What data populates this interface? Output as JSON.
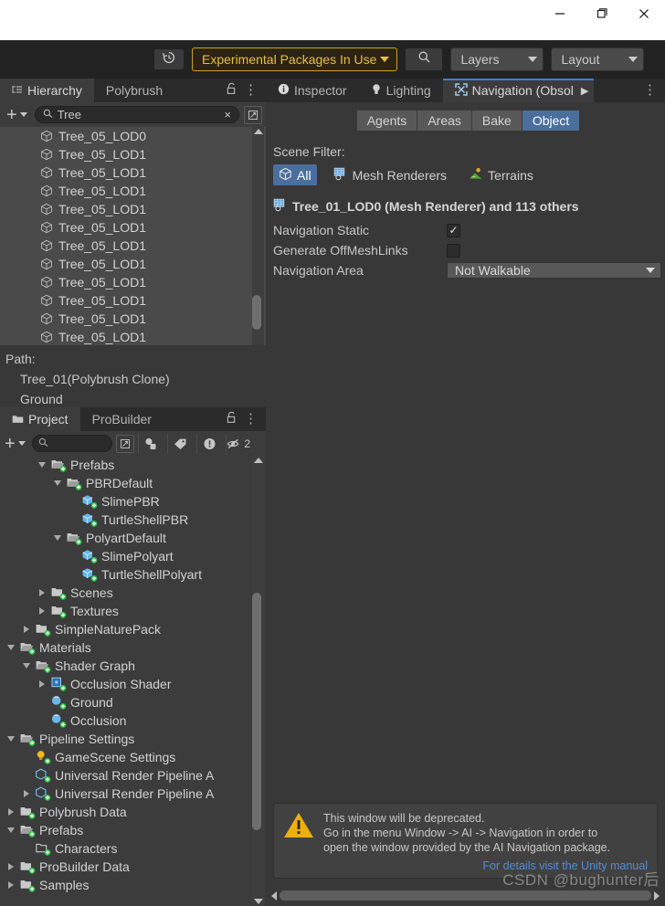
{
  "window": {
    "controls": [
      {
        "name": "minimize",
        "glyph": "minimize-icon"
      },
      {
        "name": "maximize",
        "glyph": "maximize-icon"
      },
      {
        "name": "close",
        "glyph": "close-icon"
      }
    ]
  },
  "toolbar": {
    "history_icon": "history-icon",
    "experimental_label": "Experimental Packages In Use",
    "search_icon": "search-icon",
    "layers_label": "Layers",
    "layout_label": "Layout"
  },
  "hierarchy": {
    "tabs": [
      {
        "label": "Hierarchy",
        "active": true,
        "icon": "hierarchy-icon"
      },
      {
        "label": "Polybrush",
        "active": false,
        "icon": ""
      }
    ],
    "lock_icon": "lock-icon",
    "menu_icon": "kebab-menu-icon",
    "add_label": "+",
    "search_value": "Tree",
    "search_placeholder": "Search",
    "clear_label": "×",
    "items": [
      "Tree_05_LOD0",
      "Tree_05_LOD1",
      "Tree_05_LOD1",
      "Tree_05_LOD1",
      "Tree_05_LOD1",
      "Tree_05_LOD1",
      "Tree_05_LOD1",
      "Tree_05_LOD1",
      "Tree_05_LOD1",
      "Tree_05_LOD1",
      "Tree_05_LOD1",
      "Tree_05_LOD1"
    ]
  },
  "path": {
    "title": "Path:",
    "lines": [
      "Tree_01(Polybrush Clone)",
      "Ground"
    ]
  },
  "project": {
    "tabs": [
      {
        "label": "Project",
        "active": true,
        "icon": "folder-icon"
      },
      {
        "label": "ProBuilder",
        "active": false,
        "icon": ""
      }
    ],
    "lock_icon": "lock-icon",
    "menu_icon": "kebab-menu-icon",
    "search_placeholder": "",
    "filter_count": "2",
    "tree": [
      {
        "label": "Prefabs",
        "indent": 2,
        "tri": "down",
        "icon": "folder-open",
        "badge": true
      },
      {
        "label": "PBRDefault",
        "indent": 3,
        "tri": "down",
        "icon": "folder-open",
        "badge": true
      },
      {
        "label": "SlimePBR",
        "indent": 4,
        "tri": "none",
        "icon": "prefab",
        "badge": true
      },
      {
        "label": "TurtleShellPBR",
        "indent": 4,
        "tri": "none",
        "icon": "prefab",
        "badge": true
      },
      {
        "label": "PolyartDefault",
        "indent": 3,
        "tri": "down",
        "icon": "folder-open",
        "badge": true
      },
      {
        "label": "SlimePolyart",
        "indent": 4,
        "tri": "none",
        "icon": "prefab",
        "badge": true
      },
      {
        "label": "TurtleShellPolyart",
        "indent": 4,
        "tri": "none",
        "icon": "prefab",
        "badge": true
      },
      {
        "label": "Scenes",
        "indent": 2,
        "tri": "right",
        "icon": "folder",
        "badge": true
      },
      {
        "label": "Textures",
        "indent": 2,
        "tri": "right",
        "icon": "folder",
        "badge": true
      },
      {
        "label": "SimpleNaturePack",
        "indent": 1,
        "tri": "right",
        "icon": "folder",
        "badge": true
      },
      {
        "label": "Materials",
        "indent": 0,
        "tri": "down",
        "icon": "folder-open",
        "badge": true
      },
      {
        "label": "Shader Graph",
        "indent": 1,
        "tri": "down",
        "icon": "folder-open",
        "badge": true
      },
      {
        "label": "Occlusion Shader",
        "indent": 2,
        "tri": "right",
        "icon": "shader",
        "badge": true
      },
      {
        "label": "Ground",
        "indent": 2,
        "tri": "none",
        "icon": "material",
        "badge": true
      },
      {
        "label": "Occlusion",
        "indent": 2,
        "tri": "none",
        "icon": "material",
        "badge": true
      },
      {
        "label": "Pipeline Settings",
        "indent": 0,
        "tri": "down",
        "icon": "folder-open",
        "badge": true
      },
      {
        "label": "GameScene Settings",
        "indent": 1,
        "tri": "none",
        "icon": "lightbulb",
        "badge": true
      },
      {
        "label": "Universal Render Pipeline A",
        "indent": 1,
        "tri": "none",
        "icon": "asset",
        "badge": true
      },
      {
        "label": "Universal Render Pipeline A",
        "indent": 1,
        "tri": "right",
        "icon": "asset",
        "badge": true
      },
      {
        "label": "Polybrush Data",
        "indent": 0,
        "tri": "right",
        "icon": "folder",
        "badge": true
      },
      {
        "label": "Prefabs",
        "indent": 0,
        "tri": "down",
        "icon": "folder-open",
        "badge": true
      },
      {
        "label": "Characters",
        "indent": 1,
        "tri": "none",
        "icon": "folder-empty",
        "badge": true
      },
      {
        "label": "ProBuilder Data",
        "indent": 0,
        "tri": "right",
        "icon": "folder",
        "badge": true
      },
      {
        "label": "Samples",
        "indent": 0,
        "tri": "right",
        "icon": "folder",
        "badge": true
      }
    ]
  },
  "inspector": {
    "tabs": [
      {
        "label": "Inspector",
        "active": false,
        "icon": "info-icon"
      },
      {
        "label": "Lighting",
        "active": false,
        "icon": "lightbulb-icon"
      },
      {
        "label": "Navigation (Obsol",
        "active": true,
        "icon": "navigation-icon"
      }
    ],
    "overflow_icon": "chevron-right-icon",
    "menu_icon": "kebab-menu-icon",
    "segments": [
      {
        "label": "Agents",
        "selected": false
      },
      {
        "label": "Areas",
        "selected": false
      },
      {
        "label": "Bake",
        "selected": false
      },
      {
        "label": "Object",
        "selected": true
      }
    ],
    "scene_filter_label": "Scene Filter:",
    "filters": [
      {
        "label": "All",
        "selected": true,
        "icon": "cube-icon"
      },
      {
        "label": "Mesh Renderers",
        "selected": false,
        "icon": "mesh-renderer-icon"
      },
      {
        "label": "Terrains",
        "selected": false,
        "icon": "terrain-icon"
      }
    ],
    "object_header": "Tree_01_LOD0 (Mesh Renderer) and 113 others",
    "object_header_icon": "mesh-renderer-icon",
    "properties": [
      {
        "label": "Navigation Static",
        "type": "checkbox",
        "value": true
      },
      {
        "label": "Generate OffMeshLinks",
        "type": "checkbox",
        "value": false
      },
      {
        "label": "Navigation Area",
        "type": "dropdown",
        "value": "Not Walkable"
      }
    ],
    "warning": {
      "icon": "warning-icon",
      "lines": [
        "This window will be deprecated.",
        "Go in the menu Window -> AI -> Navigation in order to",
        "open the window provided by the AI Navigation package."
      ],
      "link": "For details visit the Unity manual"
    }
  },
  "watermark": "CSDN @bughunter后",
  "colors": {
    "accent_blue": "#4a6f9c",
    "tab_accent": "#3b7fd4",
    "experimental_yellow": "#e8bf45",
    "link_blue": "#4f8fd8",
    "panel_bg": "#383838",
    "list_bg": "#3c3c3c",
    "hierarchy_list_bg": "#4a4a4a"
  }
}
